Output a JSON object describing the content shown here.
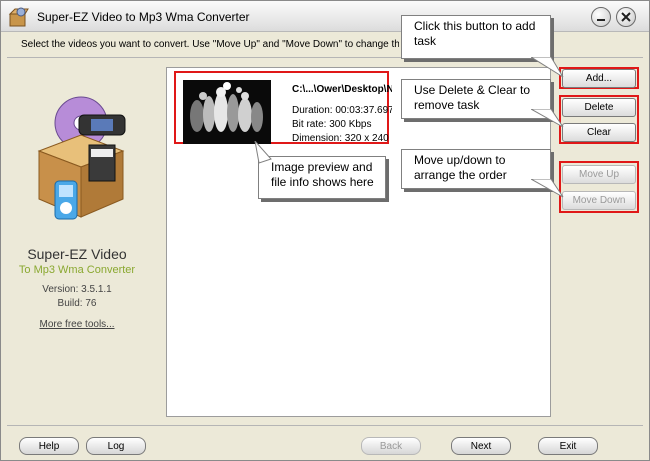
{
  "window": {
    "title": "Super-EZ Video to Mp3 Wma Converter",
    "minimize_icon": "minimize-icon",
    "close_icon": "close-icon"
  },
  "instruction": "Select the videos you want to convert. Use \"Move Up\" and \"Move Down\" to change the order",
  "sidebar": {
    "product_name": "Super-EZ Video",
    "product_subtitle": "To Mp3 Wma Converter",
    "version": "Version: 3.5.1.1",
    "build": "Build: 76",
    "more_tools": "More free tools..."
  },
  "task": {
    "path": "C:\\...\\Ower\\Desktop\\N",
    "duration": "Duration: 00:03:37.697",
    "bitrate": "Bit rate: 300 Kbps",
    "dimension": "Dimension: 320 x 240"
  },
  "buttons": {
    "add": "Add...",
    "delete": "Delete",
    "clear": "Clear",
    "move_up": "Move Up",
    "move_down": "Move Down"
  },
  "callouts": {
    "add": "Click this button to add task",
    "delete_clear": "Use Delete & Clear to remove task",
    "preview": "Image preview and file info shows here",
    "move": "Move up/down to arrange the order"
  },
  "footer": {
    "help": "Help",
    "log": "Log",
    "back": "Back",
    "next": "Next",
    "exit": "Exit"
  },
  "colors": {
    "highlight": "#e01818",
    "subtitle": "#8aa830"
  }
}
